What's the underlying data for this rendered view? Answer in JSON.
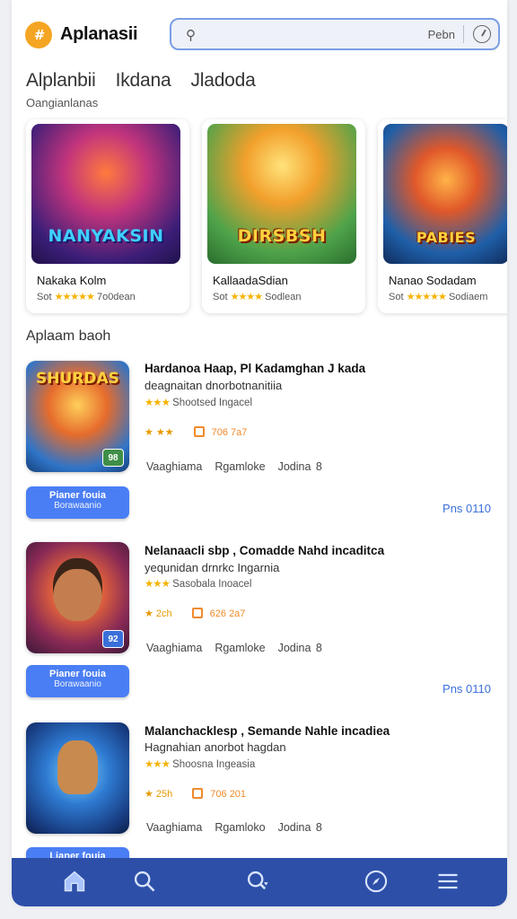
{
  "header": {
    "app_name": "Aplanasii",
    "search_placeholder": "Pebn",
    "icons": [
      "app-logo-icon",
      "search-icon",
      "clock-icon"
    ]
  },
  "tabs": [
    "Alplanbii",
    "Ikdana",
    "Jladoda"
  ],
  "subheading": "Oangianlanas",
  "featured": [
    {
      "name": "Nakaka Kolm",
      "meta_left": "Sot",
      "stars": "★★★★★",
      "meta_right": "7o0dean",
      "art_text": "NANYAKSIN"
    },
    {
      "name": "KallaadaSdian",
      "meta_left": "Sot",
      "stars": "★★★★",
      "meta_right": "Sodlean",
      "art_text": "DIRSBSH"
    },
    {
      "name": "Nanao Sodadam",
      "meta_left": "Sot",
      "stars": "★★★★★",
      "meta_right": "Sodiaem",
      "art_text": "PABIES"
    }
  ],
  "section_title": "Aplaam baoh",
  "list": [
    {
      "title": "Hardanoa Haap, Pl Kadamghan J kada",
      "subtitle": "deagnaitan dnorbotnanitiia",
      "rating_text": "Shootsed Ingacel",
      "stat_stars": "★ ★★",
      "stat_value": "706 7a7",
      "meta": [
        "Vaaghiama",
        "Rgamloke",
        "Jodina 8"
      ],
      "button_line1": "Pianer fouia",
      "button_line2": "Borawaanio",
      "price": "Pns 0110",
      "thumb_text": "SHURDAS",
      "thumb_tag": "98"
    },
    {
      "title": "Nelanaacli sbp , Comadde Nahd incaditca",
      "subtitle": "yequnidan drnrkc Ingarnia",
      "rating_text": "Sasobala Inoacel",
      "stat_stars": "★ 2ch",
      "stat_value": "626 2a7",
      "meta": [
        "Vaaghiama",
        "Rgamloke",
        "Jodina 8"
      ],
      "button_line1": "Pianer fouia",
      "button_line2": "Borawaanio",
      "price": "Pns 0110",
      "thumb_text": "",
      "thumb_tag": "92"
    },
    {
      "title": "Malanchacklesp , Semande Nahle incadiea",
      "subtitle": "Hagnahian anorbot hagdan",
      "rating_text": "Shoosna Ingeasia",
      "stat_stars": "★ 25h",
      "stat_value": "706 201",
      "meta": [
        "Vaaghiama",
        "Rgamloko",
        "Jodina 8"
      ],
      "button_line1": "Lianer fouia",
      "button_line2": "",
      "price": "",
      "thumb_text": "",
      "thumb_tag": ""
    }
  ],
  "colors": {
    "accent": "#4a7ef4",
    "navbar": "#2d4fa8",
    "star": "#f5b301"
  },
  "nav_icons": [
    "home-icon",
    "search-icon",
    "search-filter-icon",
    "compass-icon",
    "menu-icon"
  ]
}
